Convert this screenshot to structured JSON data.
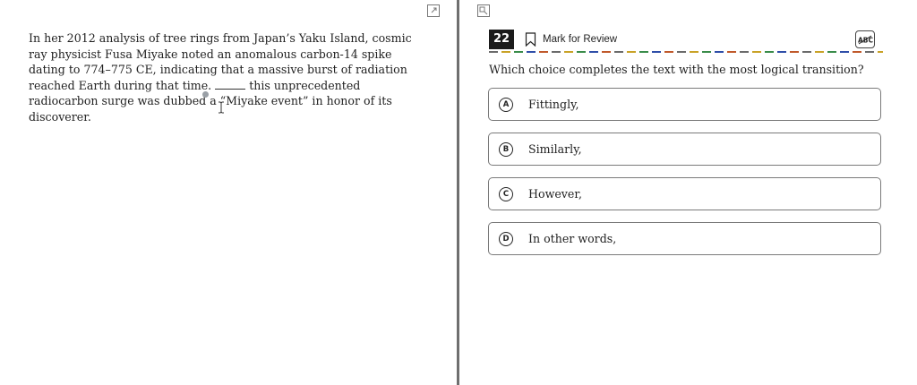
{
  "passage": {
    "before_blank": "In her 2012 analysis of tree rings from Japan’s Yaku Island, cosmic ray physicist Fusa Miyake noted an anomalous carbon-14 spike dating to 774–775 CE, indicating that a massive burst of radiation reached Earth during that time.",
    "after_blank": "this unprecedented radiocarbon surge was dubbed a “Miyake event” in honor of its discoverer."
  },
  "question_header": {
    "number": "22",
    "mark_for_review": "Mark for Review",
    "abc_label": "ABC"
  },
  "question": {
    "prompt": "Which choice completes the text with the most logical transition?"
  },
  "choices": [
    {
      "letter": "A",
      "text": "Fittingly,"
    },
    {
      "letter": "B",
      "text": "Similarly,"
    },
    {
      "letter": "C",
      "text": "However,"
    },
    {
      "letter": "D",
      "text": "In other words,"
    }
  ],
  "icons": {
    "expand": "expand-icon",
    "collapse": "collapse-icon",
    "bookmark": "bookmark-icon",
    "abc_strikethrough": "abc-strikethrough-icon",
    "text_cursor": "text-cursor-icon"
  },
  "colors": {
    "divider": "#6f6f6f",
    "question_number_bg": "#1b1b1b",
    "choice_border": "#7a7a7a"
  }
}
